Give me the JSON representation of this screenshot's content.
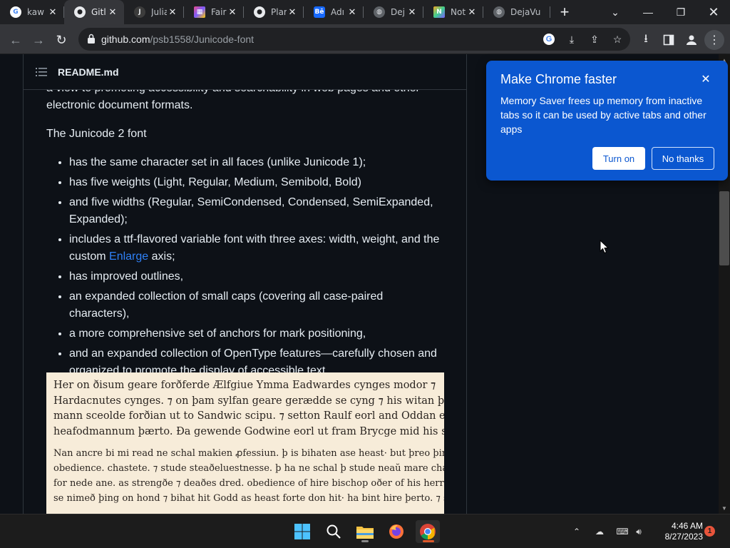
{
  "browser": {
    "tabs": [
      {
        "title": "kaw",
        "favicon": "google-g",
        "active": false
      },
      {
        "title": "Gitl",
        "favicon": "github",
        "active": true
      },
      {
        "title": "Julia",
        "favicon": "julia",
        "active": false
      },
      {
        "title": "Fair",
        "favicon": "fair-icon",
        "active": false
      },
      {
        "title": "Plar",
        "favicon": "github",
        "active": false
      },
      {
        "title": "Adı",
        "favicon": "behance",
        "active": false
      },
      {
        "title": "Dej",
        "favicon": "globe",
        "active": false
      },
      {
        "title": "Not",
        "favicon": "notion-icon",
        "active": false
      },
      {
        "title": "DejaVu",
        "favicon": "globe",
        "active": false
      }
    ],
    "url_host": "github.com",
    "url_path": "/psb1558/Junicode-font"
  },
  "readme": {
    "title": "README.md",
    "intro_fragment": "a view to promoting accessibility and searchability in web pages and other electronic document formats.",
    "font_heading": "The Junicode 2 font",
    "features": [
      "has the same character set in all faces (unlike Junicode 1);",
      "has five weights (Light, Regular, Medium, Semibold, Bold)",
      "and five widths (Regular, SemiCondensed, Condensed, SemiExpanded, Expanded);",
      "includes a ttf-flavored variable font with three axes: width, weight, and the custom ",
      "has improved outlines,",
      "an expanded collection of small caps (covering all case-paired characters),",
      "a more comprehensive set of anchors for mark positioning,",
      "and an expanded collection of OpenType features—carefully chosen and organized to promote the display of accessible text."
    ],
    "enlarge_link": "Enlarge",
    "enlarge_suffix": " axis;",
    "sample_lines_1": [
      "Her on ðisum geare forðferde Ælfgiue Ymma Eadwardes cynges modor ⁊",
      "Hardacnutes cynges. ⁊ on þam sylfan geare gerædde se cyng ⁊ his witan þæt",
      "mann sceolde forðian ut to Sandwic scipu. ⁊ setton Raulf eorl and Oddan eorl to",
      "heafodmannum þærto. Ða gewende Godwine eorl ut fram Brycge mid his scypum"
    ],
    "sample_lines_2": [
      "Nan ancre bi mi read ne schal makien ꝓfessiun. þ is bihaten ase heast· but þreo þinges. þ beoð",
      "obedience. chastete. ⁊ stude steaðeluestnesse. þ ha ne schal þ stude neaŭ mare changin bute",
      "for nede ane. as strengðe ⁊ deaðes dred. obedience of hire bischop oðer of his herre. for hpa",
      "se nimeð þing on hond ⁊ bihat hit Godd as heast forte don hit· ha bint hire þerto. ⁊ suneǥeð"
    ]
  },
  "popup": {
    "title": "Make Chrome faster",
    "body": "Memory Saver frees up memory from inactive tabs so it can be used by active tabs and other apps",
    "turn_on": "Turn on",
    "no_thanks": "No thanks",
    "color": "#0b57d0"
  },
  "taskbar": {
    "time": "4:46 AM",
    "date": "8/27/2023",
    "notification_count": "1"
  }
}
